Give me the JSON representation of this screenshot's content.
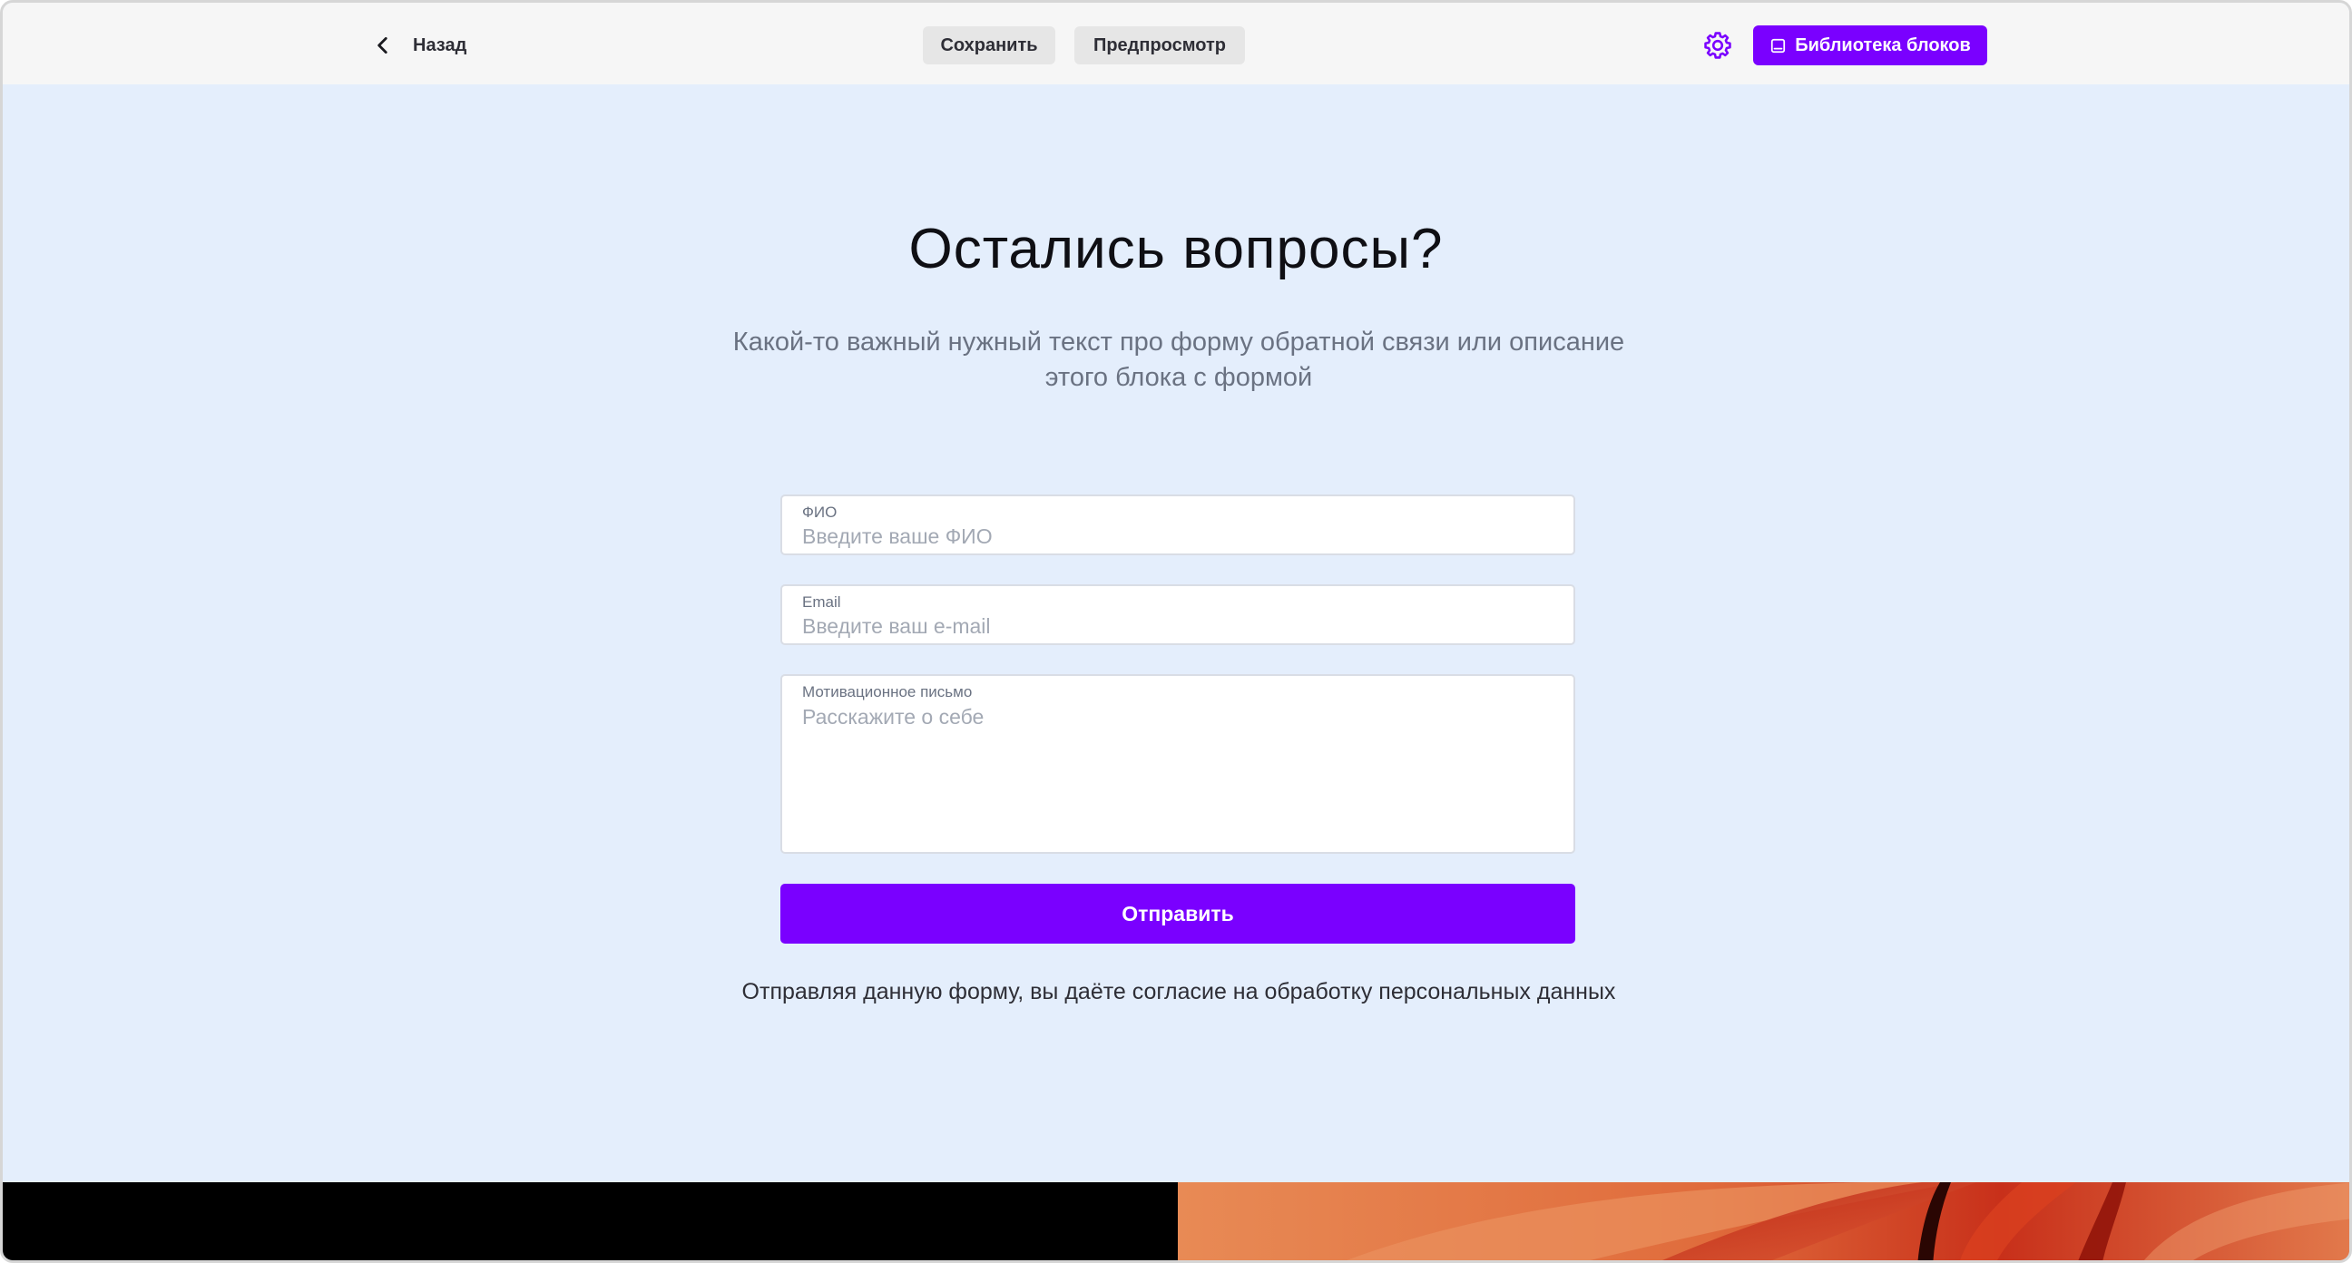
{
  "toolbar": {
    "back_label": "Назад",
    "save_label": "Сохранить",
    "preview_label": "Предпросмотр",
    "library_label": "Библиотека блоков"
  },
  "form_block": {
    "title": "Остались вопросы?",
    "subtitle": "Какой-то важный нужный текст про форму обратной связи или описание этого блока с формой",
    "fields": [
      {
        "label": "ФИО",
        "value": "",
        "placeholder": "Введите ваше ФИО"
      },
      {
        "label": "Email",
        "value": "",
        "placeholder": "Введите ваш e-mail"
      },
      {
        "label": "Мотивационное письмо",
        "value": "",
        "placeholder": "Расскажите о себе"
      }
    ],
    "submit_label": "Отправить",
    "consent_text": "Отправляя данную форму, вы даёте согласие на обработку персональных данных"
  },
  "icons": {
    "back": "chevron-left-icon",
    "settings": "gear-icon",
    "library": "image-icon"
  },
  "colors": {
    "accent": "#7a00ff",
    "page_background": "#e4eefc",
    "toolbar_background": "#f6f6f6",
    "footer_left": "#000000",
    "footer_right": "#e2784a"
  }
}
